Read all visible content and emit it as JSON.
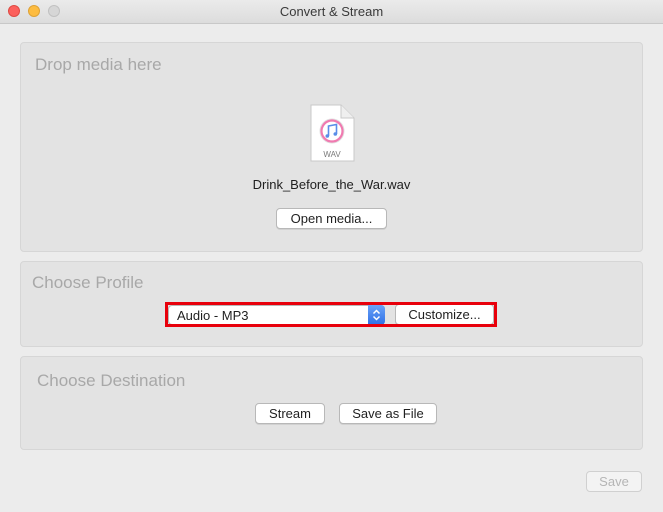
{
  "window": {
    "title": "Convert & Stream"
  },
  "drop_section": {
    "title": "Drop media here",
    "file_icon": "wav-file-icon",
    "file_type_label": "WAV",
    "file_name": "Drink_Before_the_War.wav",
    "open_button": "Open media..."
  },
  "profile_section": {
    "title": "Choose Profile",
    "selected_profile": "Audio - MP3",
    "customize_button": "Customize..."
  },
  "destination_section": {
    "title": "Choose Destination",
    "stream_button": "Stream",
    "save_as_file_button": "Save as File"
  },
  "footer": {
    "save_button": "Save",
    "save_enabled": false
  },
  "colors": {
    "highlight": "#e8000b",
    "select_accent": "#2f6fe6"
  }
}
